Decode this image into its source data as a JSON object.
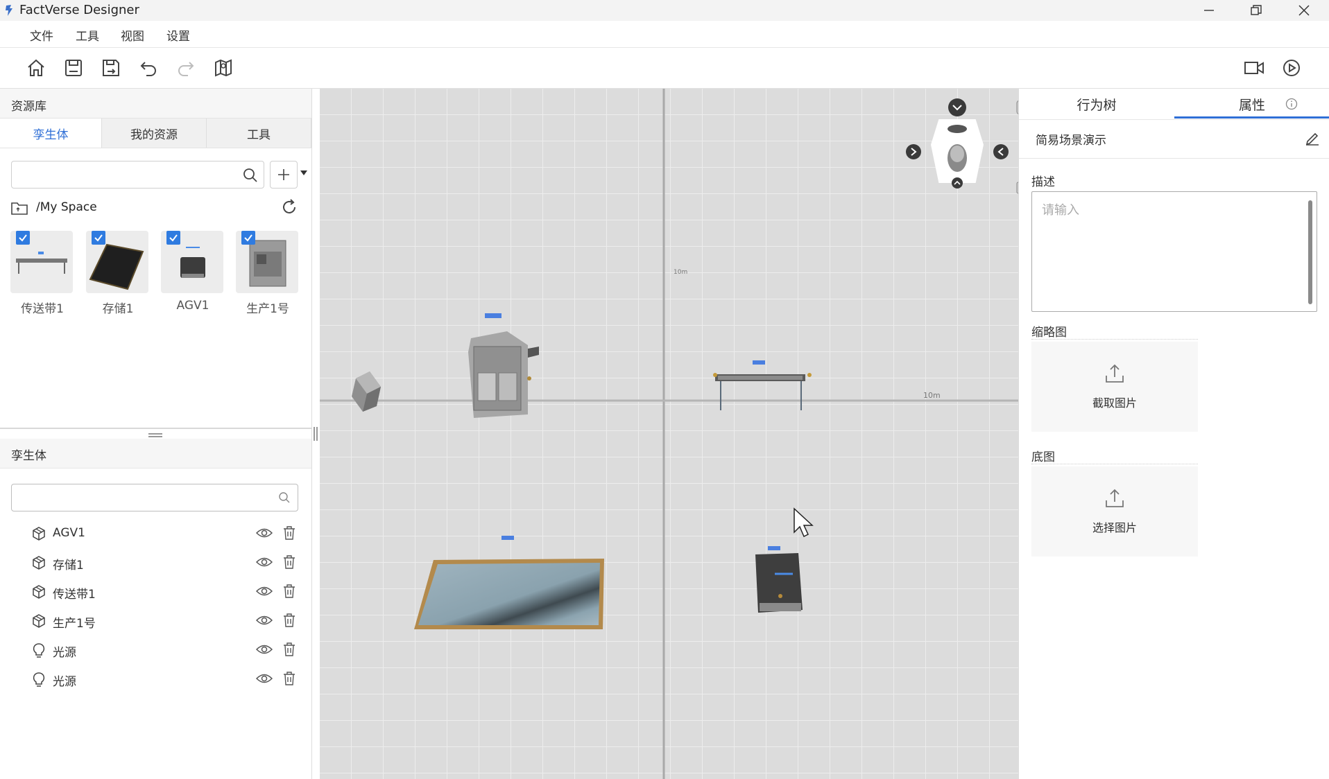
{
  "app": {
    "title": "FactVerse Designer"
  },
  "menu": {
    "items": [
      "文件",
      "工具",
      "视图",
      "设置"
    ]
  },
  "library": {
    "title": "资源库",
    "tabs": [
      "孪生体",
      "我的资源",
      "工具"
    ],
    "search_placeholder": "",
    "path": "/My Space",
    "assets": [
      {
        "label": "传送带1",
        "checked": true
      },
      {
        "label": "存储1",
        "checked": true
      },
      {
        "label": "AGV1",
        "checked": true
      },
      {
        "label": "生产1号",
        "checked": true
      }
    ]
  },
  "twin": {
    "title": "孪生体",
    "search_placeholder": "",
    "items": [
      {
        "label": "AGV1",
        "icon": "cube-icon"
      },
      {
        "label": "存储1",
        "icon": "cube-icon"
      },
      {
        "label": "传送带1",
        "icon": "cube-icon"
      },
      {
        "label": "生产1号",
        "icon": "cube-icon"
      },
      {
        "label": "光源",
        "icon": "lightbulb-icon"
      },
      {
        "label": "光源",
        "icon": "lightbulb-icon"
      }
    ]
  },
  "viewport": {
    "grid_labels": [
      "10m",
      "10m"
    ]
  },
  "right": {
    "tabs": [
      "行为树",
      "属性"
    ],
    "active_tab": "属性",
    "scene_name": "简易场景演示",
    "desc_label": "描述",
    "desc_placeholder": "请输入",
    "thumbnail_label": "缩略图",
    "thumbnail_action": "截取图片",
    "base_label": "底图",
    "base_action": "选择图片"
  },
  "colors": {
    "accent": "#2f6fd6",
    "checkbox": "#2f7be0"
  }
}
